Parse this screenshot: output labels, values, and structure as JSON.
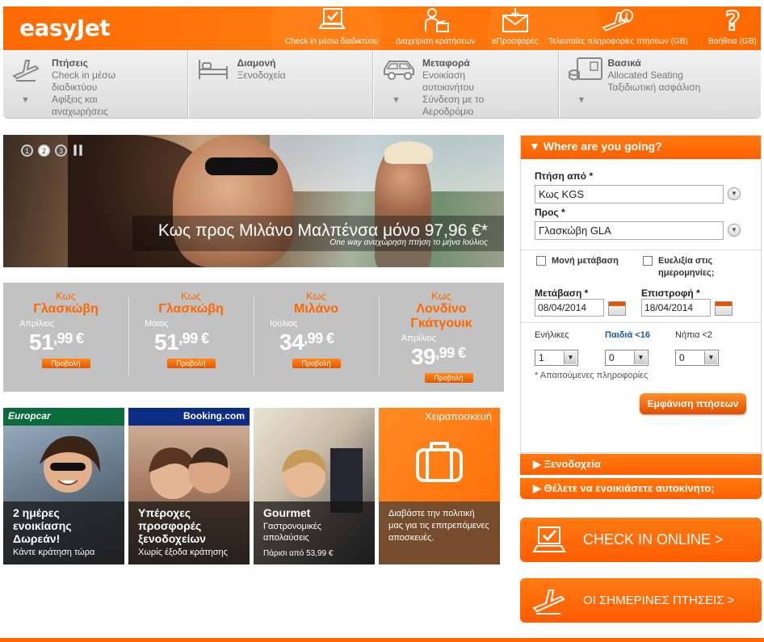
{
  "header": {
    "logo": "easyJet",
    "nav": [
      {
        "label": "Check in μέσω διαδικτύου",
        "icon": "laptop-check-icon"
      },
      {
        "label": "Διαχείριση κρατήσεων",
        "icon": "person-desk-icon"
      },
      {
        "label": "eΠροσφορές",
        "icon": "envelope-icon"
      },
      {
        "label": "Τελευταίες πληροφορίες πτήσεων (GB)",
        "icon": "plane-info-icon"
      },
      {
        "label": "Βοήθεια (GB)",
        "icon": "question-icon"
      }
    ]
  },
  "subnav": [
    {
      "title": "Πτήσεις",
      "items": [
        "Check in μέσω",
        "διαδικτύου",
        "Αφίξεις και",
        "αναχωρήσεις"
      ],
      "icon": "plane-icon"
    },
    {
      "title": "Διαμονή",
      "items": [
        "Ξενοδοχεία"
      ],
      "icon": "bed-icon"
    },
    {
      "title": "Μεταφορά",
      "items": [
        "Ενοικίαση",
        "αυτοκινήτου",
        "Σύνδεση με το",
        "Αεροδρόμιο"
      ],
      "icon": "car-icon"
    },
    {
      "title": "Βασικά",
      "items": [
        "Allocated Seating",
        "Ταξιδιωτική ασφάλιση"
      ],
      "icon": "passport-icon"
    }
  ],
  "hero": {
    "headline": "Κως προς Μιλάνο Μαλπένσα μόνο 97,96 €*",
    "subline": "One way αναχώρηση πτήση το μήνα Ιούλιος",
    "pager": [
      "1",
      "2",
      "3"
    ],
    "active_slide": 2
  },
  "deals": [
    {
      "from": "Κως",
      "to": "Γλασκώβη",
      "month": "Απρίλιος",
      "price_int": "51",
      "price_dec": ",99 €",
      "button": "Προβολή"
    },
    {
      "from": "Κως",
      "to": "Γλασκώβη",
      "month": "Μάιος",
      "price_int": "51",
      "price_dec": ",99 €",
      "button": "Προβολή"
    },
    {
      "from": "Κως",
      "to": "Μιλάνο",
      "month": "Ιούλιος",
      "price_int": "34",
      "price_dec": ",99 €",
      "button": "Προβολή"
    },
    {
      "from": "Κως",
      "to": "Λονδίνο Γκάτγουικ",
      "month": "Απρίλιος",
      "price_int": "39",
      "price_dec": ",99 €",
      "button": "Προβολή"
    }
  ],
  "tiles": [
    {
      "brand": "Europcar",
      "headline": "2 ημέρες ενοικίασης Δωρεάν!",
      "sub": "Κάντε κράτηση τώρα"
    },
    {
      "brand": "Booking.com",
      "headline": "Υπέροχες προσφορές ξενοδοχείων",
      "sub": "Χωρίς έξοδα κράτησης"
    },
    {
      "brand": "",
      "headline": "Gourmet",
      "sub": "Γαστρονομικές απολαύσεις",
      "sub2": "Πάρισι από 53,99 €"
    },
    {
      "brand": "Χειραποσκευή",
      "headline": "",
      "sub": "Διαβάστε την πολιτική μας για τις επιτρεπόμενες αποσκευές."
    }
  ],
  "search": {
    "title": "▼ Where are you going?",
    "from_label": "Πτήση από *",
    "from_value": "Κως KGS",
    "to_label": "Προς *",
    "to_value": "Γλασκώβη GLA",
    "oneway_label": "Μονή μετάβαση",
    "flex_label": "Ευελιξία στις ημερομηνίες;",
    "depart_label": "Μετάβαση *",
    "depart_value": "08/04/2014",
    "return_label": "Επιστροφή *",
    "return_value": "18/04/2014",
    "adults_label": "Ενήλικες",
    "children_label": "Παιδιά <16",
    "infants_label": "Νήπια <2",
    "adults_value": "1",
    "children_value": "0",
    "infants_value": "0",
    "required_note": "* Απαιτούμενες πληροφορίες",
    "submit": "Εμφάνιση πτήσεων"
  },
  "accordions": [
    "▶ Ξενοδοχεία",
    "▶ Θέλετε να ενοικιάσετε αυτοκίνητο;"
  ],
  "big_buttons": [
    {
      "label": "CHECK IN ONLINE >",
      "icon": "laptop-check-icon"
    },
    {
      "label": "ΟΙ ΣΗΜΕΡΙΝΕΣ ΠΤΗΣΕΙΣ >",
      "icon": "plane-icon"
    }
  ],
  "colors": {
    "brand_orange": "#ff6600",
    "grey_panel": "#c2c2c2"
  }
}
